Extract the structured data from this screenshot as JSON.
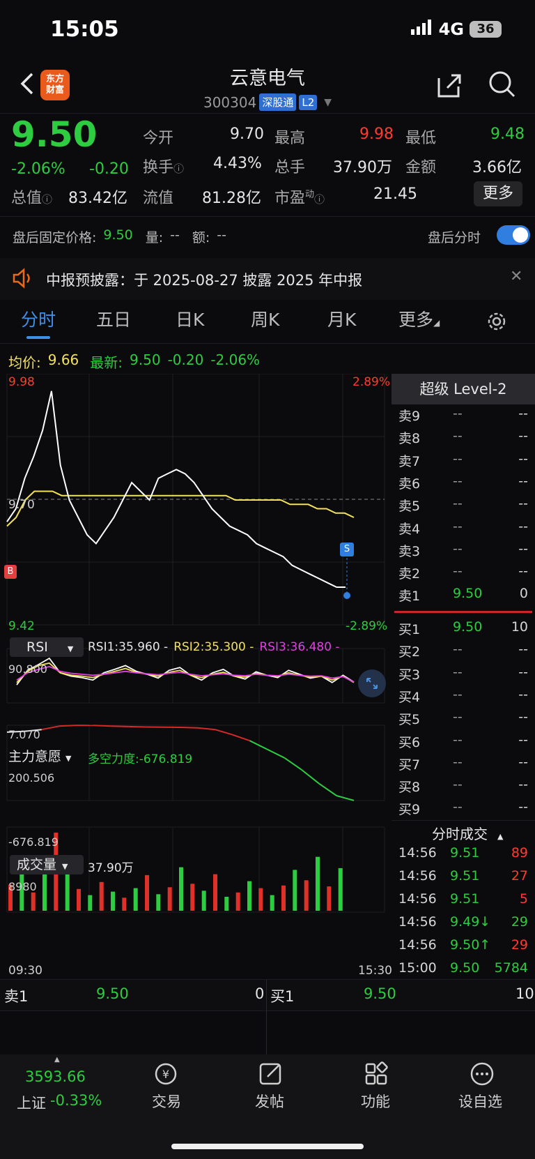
{
  "status": {
    "time": "15:05",
    "network": "4G",
    "battery": "36"
  },
  "header": {
    "title": "云意电气",
    "code": "300304",
    "tag_connect": "深股通",
    "tag_level": "L2",
    "logo_text_1": "东方",
    "logo_text_2": "财富"
  },
  "quote": {
    "price": "9.50",
    "change_pct": "-2.06%",
    "change": "-0.20",
    "labels": {
      "open": "今开",
      "high": "最高",
      "low": "最低",
      "turnover": "换手",
      "volume": "总手",
      "amount": "金额",
      "mcap": "总值",
      "float_mcap": "流值",
      "pe": "市盈",
      "pe_sup": "动"
    },
    "open": "9.70",
    "high": "9.98",
    "low": "9.48",
    "turnover": "4.43%",
    "volume": "37.90万",
    "amount": "3.66亿",
    "mcap": "83.42亿",
    "float_mcap": "81.28亿",
    "pe": "21.45",
    "more": "更多"
  },
  "after_hours": {
    "label": "盘后固定价格:",
    "price": "9.50",
    "vol_label": "量:",
    "vol": "--",
    "amt_label": "额:",
    "amt": "--",
    "toggle_label": "盘后分时",
    "toggle_on": true
  },
  "notice": {
    "text": "中报预披露：于 2025-08-27 披露 2025 年中报"
  },
  "tabs": [
    "分时",
    "五日",
    "日K",
    "周K",
    "月K",
    "更多"
  ],
  "chart_info": {
    "avg_label": "均价:",
    "avg": "9.66",
    "last_label": "最新:",
    "last": "9.50",
    "chg": "-0.20",
    "chg_pct": "-2.06%"
  },
  "chart_data": [
    {
      "type": "line",
      "title": "分时",
      "y_top_label": "9.98",
      "y_mid_label": "9.70",
      "y_bottom_label": "9.42",
      "pct_top": "2.89%",
      "pct_bottom": "-2.89%",
      "ylim": [
        9.42,
        9.98
      ],
      "x_start": "09:30",
      "x_end": "15:30",
      "marker_b": "B",
      "marker_s": "S",
      "series": [
        {
          "name": "价格",
          "color": "#ffffff",
          "values": [
            9.65,
            9.68,
            9.75,
            9.8,
            9.86,
            9.95,
            9.78,
            9.7,
            9.66,
            9.62,
            9.6,
            9.63,
            9.66,
            9.7,
            9.74,
            9.72,
            9.7,
            9.75,
            9.76,
            9.77,
            9.76,
            9.74,
            9.71,
            9.68,
            9.66,
            9.64,
            9.63,
            9.62,
            9.6,
            9.59,
            9.58,
            9.57,
            9.55,
            9.54,
            9.53,
            9.52,
            9.51,
            9.5,
            9.5
          ]
        },
        {
          "name": "均价",
          "color": "#f3e25a",
          "values": [
            9.64,
            9.66,
            9.7,
            9.72,
            9.72,
            9.72,
            9.71,
            9.71,
            9.71,
            9.71,
            9.71,
            9.71,
            9.71,
            9.71,
            9.71,
            9.71,
            9.71,
            9.71,
            9.71,
            9.71,
            9.71,
            9.71,
            9.71,
            9.71,
            9.71,
            9.7,
            9.7,
            9.7,
            9.7,
            9.7,
            9.7,
            9.69,
            9.69,
            9.69,
            9.68,
            9.68,
            9.67,
            9.67,
            9.66
          ]
        }
      ]
    },
    {
      "type": "line",
      "title": "RSI",
      "selector": "RSI",
      "legend": [
        "RSI1:35.960 -",
        "RSI2:35.300 -",
        "RSI3:36.480 -"
      ],
      "y_top_label": "90.800",
      "y_bottom_label": "7.070",
      "ylim": [
        7.07,
        90.8
      ],
      "series": [
        {
          "name": "RSI1",
          "color": "#ffffff",
          "values": [
            30,
            60,
            72,
            85,
            55,
            48,
            45,
            40,
            55,
            62,
            70,
            58,
            52,
            44,
            60,
            66,
            50,
            40,
            55,
            62,
            48,
            42,
            57,
            50,
            45,
            60,
            52,
            44,
            48,
            35,
            50,
            36
          ]
        },
        {
          "name": "RSI2",
          "color": "#f3e25a",
          "values": [
            35,
            58,
            70,
            75,
            55,
            50,
            48,
            45,
            52,
            58,
            64,
            56,
            52,
            48,
            56,
            60,
            50,
            45,
            52,
            56,
            48,
            46,
            54,
            50,
            48,
            55,
            50,
            46,
            48,
            40,
            48,
            35
          ]
        },
        {
          "name": "RSI3",
          "color": "#e040e0",
          "values": [
            40,
            55,
            62,
            68,
            58,
            54,
            52,
            50,
            52,
            55,
            58,
            55,
            53,
            51,
            54,
            56,
            52,
            49,
            51,
            53,
            50,
            49,
            52,
            50,
            49,
            52,
            50,
            48,
            49,
            44,
            47,
            36
          ]
        }
      ]
    },
    {
      "type": "line",
      "title": "主力意愿",
      "selector": "主力意愿",
      "legend": "多空力度:-676.819",
      "y_top_label": "200.506",
      "y_bottom_label": "-676.819",
      "ylim": [
        -676.819,
        200.506
      ],
      "values": [
        120,
        130,
        150,
        190,
        200,
        198,
        190,
        185,
        180,
        178,
        176,
        170,
        150,
        90,
        20,
        -80,
        -180,
        -320,
        -480,
        -620,
        -676
      ]
    },
    {
      "type": "bar",
      "title": "成交量",
      "selector": "成交量",
      "legend": "37.90万",
      "y_top_label": "8980",
      "ylim": [
        0,
        8980
      ],
      "values": [
        3000,
        5200,
        2100,
        6400,
        8980,
        4300,
        2500,
        1800,
        3300,
        2200,
        1500,
        2600,
        4100,
        1900,
        2700,
        5000,
        3100,
        2300,
        4200,
        1600,
        2100,
        3400,
        2600,
        1800,
        2900,
        4700,
        3500,
        6200,
        2800,
        4900
      ]
    }
  ],
  "level2": {
    "title": "超级 Level-2",
    "asks": [
      {
        "label": "卖9",
        "price": "--",
        "vol": "--"
      },
      {
        "label": "卖8",
        "price": "--",
        "vol": "--"
      },
      {
        "label": "卖7",
        "price": "--",
        "vol": "--"
      },
      {
        "label": "卖6",
        "price": "--",
        "vol": "--"
      },
      {
        "label": "卖5",
        "price": "--",
        "vol": "--"
      },
      {
        "label": "卖4",
        "price": "--",
        "vol": "--"
      },
      {
        "label": "卖3",
        "price": "--",
        "vol": "--"
      },
      {
        "label": "卖2",
        "price": "--",
        "vol": "--"
      },
      {
        "label": "卖1",
        "price": "9.50",
        "vol": "0"
      }
    ],
    "bids": [
      {
        "label": "买1",
        "price": "9.50",
        "vol": "10"
      },
      {
        "label": "买2",
        "price": "--",
        "vol": "--"
      },
      {
        "label": "买3",
        "price": "--",
        "vol": "--"
      },
      {
        "label": "买4",
        "price": "--",
        "vol": "--"
      },
      {
        "label": "买5",
        "price": "--",
        "vol": "--"
      },
      {
        "label": "买6",
        "price": "--",
        "vol": "--"
      },
      {
        "label": "买7",
        "price": "--",
        "vol": "--"
      },
      {
        "label": "买8",
        "price": "--",
        "vol": "--"
      },
      {
        "label": "买9",
        "price": "--",
        "vol": "--"
      }
    ],
    "trades_title": "分时成交",
    "trades": [
      {
        "time": "14:56",
        "price": "9.51",
        "vol": "89",
        "dir": "up"
      },
      {
        "time": "14:56",
        "price": "9.51",
        "vol": "27",
        "dir": "up"
      },
      {
        "time": "14:56",
        "price": "9.51",
        "vol": "5",
        "dir": "up"
      },
      {
        "time": "14:56",
        "price": "9.49↓",
        "vol": "29",
        "dir": "down"
      },
      {
        "time": "14:56",
        "price": "9.50↑",
        "vol": "29",
        "dir": "up"
      },
      {
        "time": "15:00",
        "price": "9.50",
        "vol": "5784",
        "dir": "down"
      }
    ]
  },
  "book_bar": {
    "ask_label": "卖1",
    "ask_price": "9.50",
    "ask_vol": "0",
    "bid_label": "买1",
    "bid_price": "9.50",
    "bid_vol": "10"
  },
  "footer": {
    "index_value": "3593.66",
    "index_name": "上证",
    "index_chg": "-0.33%",
    "items": [
      "交易",
      "发帖",
      "功能",
      "设自选"
    ]
  }
}
